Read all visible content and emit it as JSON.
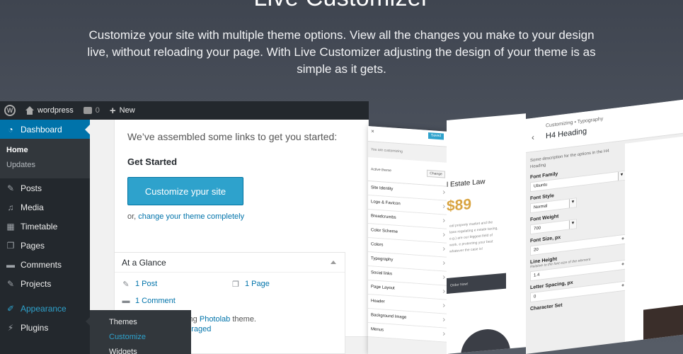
{
  "hero": {
    "title": "Live Customizer",
    "text": "Customize your site with multiple theme options. View all the changes you make to your design live, without reloading your page. With Live Customizer adjusting the design of your theme is as simple as it gets."
  },
  "admin_bar": {
    "site": "wordpress",
    "comments": "0",
    "new": "New"
  },
  "sidebar": {
    "dashboard": "Dashboard",
    "sub": [
      "Home",
      "Updates"
    ],
    "items": [
      "Posts",
      "Media",
      "Timetable",
      "Pages",
      "Comments",
      "Projects"
    ],
    "appearance": "Appearance",
    "plugins": "Plugins"
  },
  "flyout": [
    "Themes",
    "Customize",
    "Widgets"
  ],
  "welcome": {
    "intro": "We’ve assembled some links to get you started:",
    "get_started": "Get Started",
    "button": "Customize ypur site",
    "or": "or,",
    "change_link": "change your theme completely"
  },
  "glance": {
    "title": "At a Glance",
    "posts": "1 Post",
    "pages": "1 Page",
    "comments": "1 Comment",
    "theme_pre": "ning",
    "theme_name": "Photolab",
    "theme_post": "theme.",
    "discouraged": "ouraged"
  },
  "customizer_left": {
    "save": "Saved",
    "you_are": "You are customizing",
    "active_theme": "Active theme",
    "change": "Change",
    "sections": [
      "Site Identity",
      "Logo & Favicon",
      "Breadcrumbs",
      "Color Scheme",
      "Colors",
      "Typography",
      "Social links",
      "Page Layout",
      "Header",
      "Background Image",
      "Menus"
    ]
  },
  "preview": {
    "label": "l Estate Law",
    "price": "$89",
    "text": "eal property market and the laws regulating e estate taxing, e.g.) are our biggest field of work. e protecting your best whatever the case is!",
    "order": "Order Now!"
  },
  "customizer_right": {
    "crumb": "Customizing • Typography",
    "heading": "H4 Heading",
    "desc": "Some description for the options in the H4 Heading",
    "fields": [
      {
        "label": "Font Family",
        "value": "Ubuntu"
      },
      {
        "label": "Font Style",
        "value": "Normal"
      },
      {
        "label": "Font Weight",
        "value": "700"
      },
      {
        "label": "Font Size, px",
        "value": "20"
      },
      {
        "label": "Line Height",
        "sub": "Relative to the font-size of the element",
        "value": "1.4"
      },
      {
        "label": "Letter Spacing, px",
        "value": "0"
      },
      {
        "label": "Character Set"
      }
    ]
  }
}
